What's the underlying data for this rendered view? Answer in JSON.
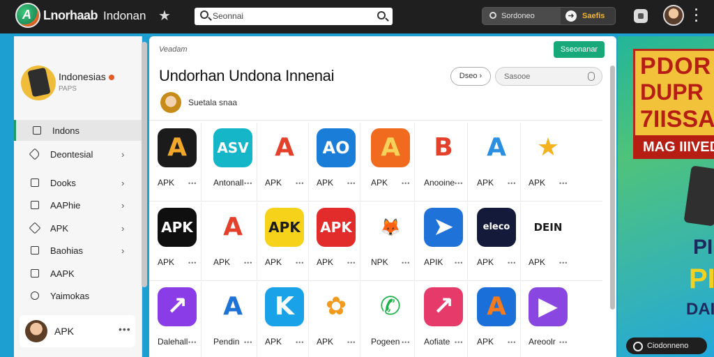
{
  "topbar": {
    "brand_primary": "Lnorhaab",
    "brand_secondary": "Indonan",
    "search_placeholder": "Seonnai",
    "pill_search": "Sordoneo",
    "pill_action": "Saefis"
  },
  "sidebar": {
    "profile_name": "Indonesias",
    "profile_sub": "PAPS",
    "items": [
      {
        "label": "Indons",
        "icon": "home-icon",
        "chevron": false,
        "active": true
      },
      {
        "label": "Deontesial",
        "icon": "tag-icon",
        "chevron": true,
        "active": false
      },
      {
        "label": "Dooks",
        "icon": "folder-icon",
        "chevron": true,
        "active": false
      },
      {
        "label": "AAPhie",
        "icon": "app-icon",
        "chevron": true,
        "active": false
      },
      {
        "label": "APK",
        "icon": "package-icon",
        "chevron": true,
        "active": false
      },
      {
        "label": "Baohias",
        "icon": "grid-icon",
        "chevron": true,
        "active": false
      },
      {
        "label": "AAPK",
        "icon": "box-icon",
        "chevron": false,
        "active": false
      },
      {
        "label": "Yaimokas",
        "icon": "chat-icon",
        "chevron": false,
        "active": false
      }
    ],
    "user_name": "APK"
  },
  "main": {
    "breadcrumb": "Veadam",
    "action_button": "Sseonanar",
    "title": "Undorhan Undona Innenai",
    "filter_chip": "Dseo ›",
    "search_placeholder": "Sasooe",
    "author_name": "Suetala snaa"
  },
  "apps": [
    {
      "label": "APK",
      "icon": "a-icon",
      "bg": "#1b1b1b",
      "fg": "#f1a82a",
      "text": "A"
    },
    {
      "label": "Antonall",
      "icon": "asv-icon",
      "bg": "#14b6c8",
      "fg": "#ffffff",
      "text": "ASV"
    },
    {
      "label": "APK",
      "icon": "a-icon",
      "bg": "#ffffff",
      "fg": "#e4412c",
      "text": "A"
    },
    {
      "label": "APK",
      "icon": "ao-icon",
      "bg": "#1a7ed8",
      "fg": "#ffffff",
      "text": "AO"
    },
    {
      "label": "APK",
      "icon": "a-icon",
      "bg": "#f06b1e",
      "fg": "#f6d25a",
      "text": "A"
    },
    {
      "label": "Anooine",
      "icon": "b-icon",
      "bg": "#ffffff",
      "fg": "#e4412c",
      "text": "B"
    },
    {
      "label": "APK",
      "icon": "a-icon",
      "bg": "#ffffff",
      "fg": "#2a8fe0",
      "text": "A"
    },
    {
      "label": "APK",
      "icon": "star-icon",
      "bg": "#ffffff",
      "fg": "#f4b21e",
      "text": "★"
    },
    {
      "label": "APK",
      "icon": "apk-icon",
      "bg": "#0f0f0f",
      "fg": "#ffffff",
      "text": "APK"
    },
    {
      "label": "APK",
      "icon": "a-icon",
      "bg": "#ffffff",
      "fg": "#e4412c",
      "text": "A"
    },
    {
      "label": "APK",
      "icon": "apk-icon",
      "bg": "#f7d21a",
      "fg": "#1b1b1b",
      "text": "APK"
    },
    {
      "label": "APK",
      "icon": "apk-icon",
      "bg": "#e22b2b",
      "fg": "#ffffff",
      "text": "APK"
    },
    {
      "label": "NPK",
      "icon": "mascot-icon",
      "bg": "#ffffff",
      "fg": "#e0782c",
      "text": "🦊"
    },
    {
      "label": "APIK",
      "icon": "paper-plane-icon",
      "bg": "#1f72d8",
      "fg": "#ffffff",
      "text": "➤"
    },
    {
      "label": "APK",
      "icon": "eleco-icon",
      "bg": "#131a3a",
      "fg": "#ffffff",
      "text": "eleco"
    },
    {
      "label": "APK",
      "icon": "burst-icon",
      "bg": "#ffffff",
      "fg": "#1b1b1b",
      "text": "DEIN"
    },
    {
      "label": "Dalehall",
      "icon": "arrow-icon",
      "bg": "#8a3de6",
      "fg": "#ffffff",
      "text": "↗"
    },
    {
      "label": "Pendin",
      "icon": "pen-icon",
      "bg": "#ffffff",
      "fg": "#1e73d6",
      "text": "A"
    },
    {
      "label": "APK",
      "icon": "k-icon",
      "bg": "#1aa2e8",
      "fg": "#ffffff",
      "text": "K"
    },
    {
      "label": "APK",
      "icon": "flower-icon",
      "bg": "#ffffff",
      "fg": "#f19a1e",
      "text": "✿"
    },
    {
      "label": "Pogeen",
      "icon": "phone-icon",
      "bg": "#ffffff",
      "fg": "#20b24a",
      "text": "✆"
    },
    {
      "label": "Aofiate",
      "icon": "shape-icon",
      "bg": "#e53a6a",
      "fg": "#ffffff",
      "text": "↗"
    },
    {
      "label": "APK",
      "icon": "a-icon",
      "bg": "#1a6fd8",
      "fg": "#f37b1e",
      "text": "A"
    },
    {
      "label": "Areoolr",
      "icon": "play-icon",
      "bg": "#8a46e0",
      "fg": "#ffffff",
      "text": "▶"
    }
  ],
  "banner": {
    "line1": "PDOR",
    "line2": "DUPR",
    "line3": "7IISSA",
    "line4": "MAG IIIVED",
    "big1": "PI",
    "big2": "PI",
    "big3": "DAI",
    "cta": "Ciodonneno"
  }
}
